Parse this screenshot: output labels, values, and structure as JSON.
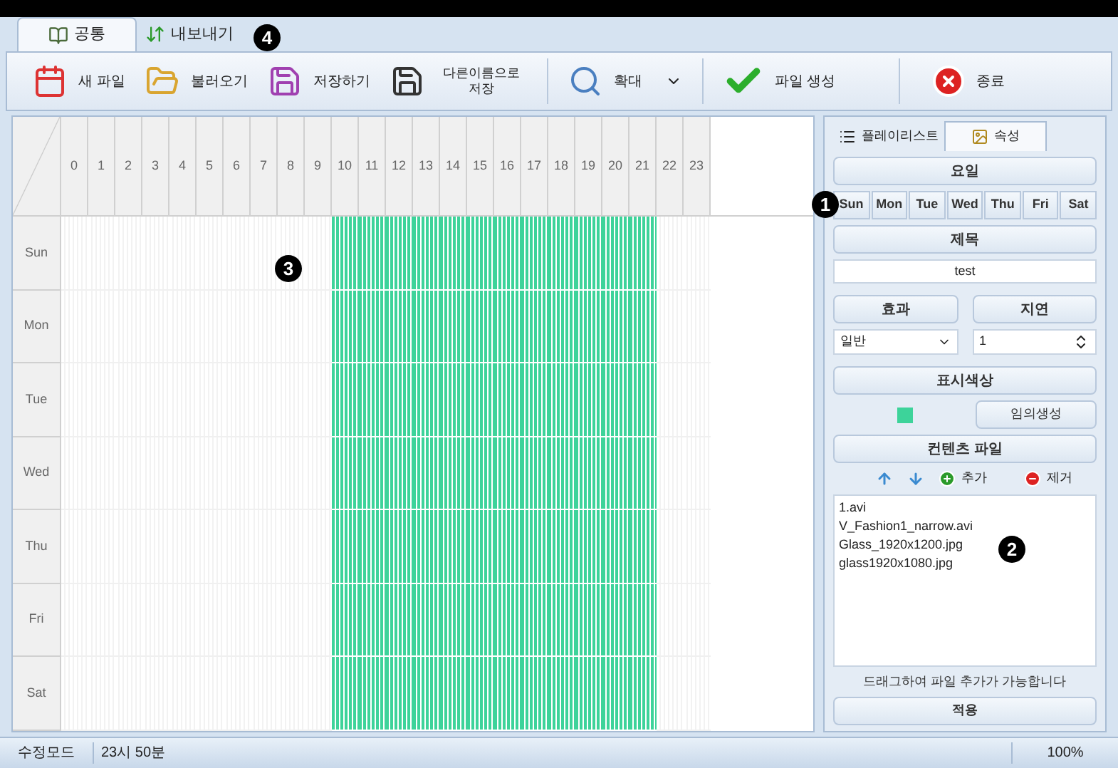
{
  "tabs": [
    {
      "label": "공통",
      "selected": true,
      "kind": "common"
    },
    {
      "label": "내보내기",
      "selected": false,
      "kind": "export"
    }
  ],
  "toolbar": [
    {
      "label": "새 파일",
      "kind": "new"
    },
    {
      "label": "불러오기",
      "kind": "open"
    },
    {
      "label": "저장하기",
      "kind": "save"
    },
    {
      "label": "다른이름으로 저장",
      "kind": "saveas"
    },
    {
      "label": "확대",
      "kind": "zoom"
    },
    {
      "label": "파일 생성",
      "kind": "build"
    },
    {
      "label": "종료",
      "kind": "exit"
    }
  ],
  "schedule": {
    "columns": [
      {
        "label": "0",
        "active": false
      },
      {
        "label": "1",
        "active": false
      },
      {
        "label": "2",
        "active": false
      },
      {
        "label": "3",
        "active": false
      },
      {
        "label": "4",
        "active": false
      },
      {
        "label": "5",
        "active": false
      },
      {
        "label": "6",
        "active": false
      },
      {
        "label": "7",
        "active": false
      },
      {
        "label": "8",
        "active": false
      },
      {
        "label": "9",
        "active": false
      },
      {
        "label": "10",
        "active": true
      },
      {
        "label": "11",
        "active": true
      },
      {
        "label": "12",
        "active": true
      },
      {
        "label": "13",
        "active": true
      },
      {
        "label": "14",
        "active": true
      },
      {
        "label": "15",
        "active": true
      },
      {
        "label": "16",
        "active": true
      },
      {
        "label": "17",
        "active": true
      },
      {
        "label": "18",
        "active": true
      },
      {
        "label": "19",
        "active": true
      },
      {
        "label": "20",
        "active": true
      },
      {
        "label": "21",
        "active": true
      },
      {
        "label": "22",
        "active": false
      },
      {
        "label": "23",
        "active": false
      }
    ],
    "rows": [
      "Sun",
      "Mon",
      "Tue",
      "Wed",
      "Thu",
      "Fri",
      "Sat"
    ]
  },
  "panel": {
    "tabs": [
      {
        "label": "플레이리스트",
        "selected": false
      },
      {
        "label": "속성",
        "selected": true
      }
    ],
    "day_header": "요일",
    "days": [
      "Sun",
      "Mon",
      "Tue",
      "Wed",
      "Thu",
      "Fri",
      "Sat"
    ],
    "title_header": "제목",
    "title_value": "test",
    "effect_header": "효과",
    "delay_header": "지연",
    "effect_value": "일반",
    "delay_value": "1",
    "color_header": "표시색상",
    "color": "#3dd39a",
    "random_button": "임의생성",
    "content_header": "컨텐츠 파일",
    "add_button": "추가",
    "remove_button": "제거",
    "files": [
      "1.avi",
      "V_Fashion1_narrow.avi",
      "Glass_1920x1200.jpg",
      "glass1920x1080.jpg"
    ],
    "hint": "드래그하여 파일 추가가 가능합니다",
    "apply_button": "적용"
  },
  "status_bar": [
    "수정모드",
    "23시 50분",
    "100%"
  ],
  "callouts": [
    "4",
    "1",
    "3",
    "2"
  ]
}
